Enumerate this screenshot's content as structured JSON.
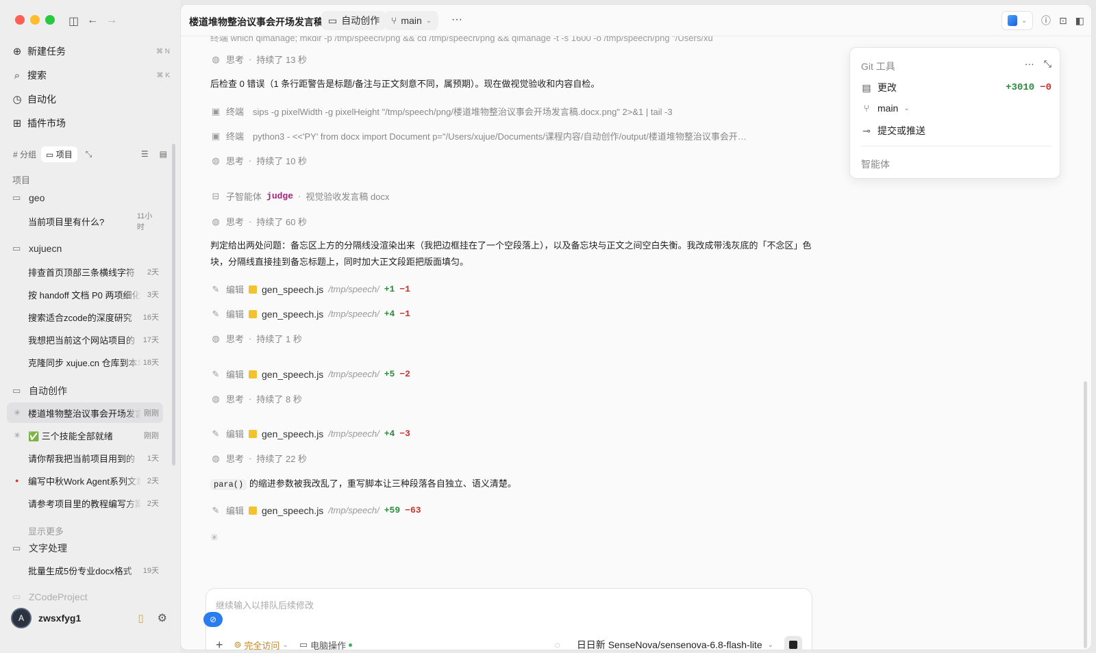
{
  "sidebar": {
    "nav": [
      {
        "icon": "new-task-icon",
        "label": "新建任务",
        "shortcut": "⌘ N"
      },
      {
        "icon": "search-icon",
        "label": "搜索",
        "shortcut": "⌘ K"
      },
      {
        "icon": "automation-icon",
        "label": "自动化",
        "shortcut": ""
      },
      {
        "icon": "plugin-icon",
        "label": "插件市场",
        "shortcut": ""
      }
    ],
    "tabs": {
      "group": "# 分组",
      "project": "项目"
    },
    "section_label": "项目",
    "projects": [
      {
        "name": "geo",
        "items": [
          {
            "title": "当前项目里有什么?",
            "time": "11小时"
          }
        ]
      },
      {
        "name": "xujuecn",
        "items": [
          {
            "title": "排查首页顶部三条横线字符",
            "time": "2天"
          },
          {
            "title": "按 handoff 文档 P0 两项细化",
            "time": "3天"
          },
          {
            "title": "搜索适合zcode的深度研究",
            "time": "16天"
          },
          {
            "title": "我想把当前这个网站项目的",
            "time": "17天"
          },
          {
            "title": "克隆同步 xujue.cn 仓库到本地",
            "time": "18天"
          }
        ]
      },
      {
        "name": "自动创作",
        "items": [
          {
            "title": "楼道堆物整治议事会开场发言稿",
            "time": "刚刚"
          },
          {
            "title": "✅ 三个技能全部就绪",
            "time": "刚刚"
          },
          {
            "title": "请你帮我把当前项目用到的",
            "time": "1天"
          },
          {
            "title": "编写中秋Work Agent系列文章",
            "time": "2天"
          },
          {
            "title": "请参考项目里的教程编写方案",
            "time": "2天"
          }
        ],
        "more": "显示更多"
      },
      {
        "name": "文字处理",
        "items": [
          {
            "title": "批量生成5份专业docx格式",
            "time": "19天"
          }
        ]
      },
      {
        "name": "ZCodeProject",
        "items": []
      }
    ],
    "user": {
      "name": "zwsxfyg1",
      "avatar_text": "A"
    }
  },
  "header": {
    "title": "楼道堆物整治议事会开场发言稿",
    "folder": "自动创作",
    "branch": "main",
    "more": "···"
  },
  "transcript": {
    "clipped_line": "终端  which qlmanage; mkdir -p /tmp/speech/png && cd /tmp/speech/png && qlmanage -t -s 1600 -o /tmp/speech/png \"/Users/xu",
    "think_label": "思考",
    "terminal_label": "终端",
    "edit_label": "编辑",
    "subagent_label": "子智能体",
    "rows": {
      "t1": "持续了 13 秒",
      "p1": "后检查 0 错误（1 条行距警告是标题/备注与正文刻意不同，属预期）。现在做视觉验收和内容自检。",
      "cmd1": "sips -g pixelWidth -g pixelHeight \"/tmp/speech/png/楼道堆物整治议事会开场发言稿.docx.png\" 2>&1 | tail -3",
      "cmd2": "python3 - <<'PY' from docx import Document p=\"/Users/xujue/Documents/课程内容/自动创作/output/楼道堆物整治议事会开…",
      "t2": "持续了 10 秒",
      "agent_name": "judge",
      "agent_task": "视觉验收发言稿 docx",
      "t3": "持续了 60 秒",
      "p2": "判定给出两处问题：备忘区上方的分隔线没渲染出来（我把边框挂在了一个空段落上），以及备忘块与正文之间空白失衡。我改成带浅灰底的「不念区」色块，分隔线直接挂到备忘标题上，同时加大正文段距把版面填匀。",
      "t4": "持续了 1 秒",
      "t5": "持续了 8 秒",
      "t6": "持续了 22 秒",
      "p3_code": "para()",
      "p3_text": "的缩进参数被我改乱了，重写脚本让三种段落各自独立、语义清楚。",
      "file": "gen_speech.js",
      "path": "/tmp/speech/",
      "edits": [
        {
          "plus": "+1",
          "minus": "−1"
        },
        {
          "plus": "+4",
          "minus": "−1"
        },
        {
          "plus": "+5",
          "minus": "−2"
        },
        {
          "plus": "+4",
          "minus": "−3"
        },
        {
          "plus": "+59",
          "minus": "−63"
        }
      ]
    }
  },
  "git_panel": {
    "title": "Git 工具",
    "changes_label": "更改",
    "added": "+3010",
    "removed": "−0",
    "branch": "main",
    "commit_label": "提交或推送",
    "agent_label": "智能体"
  },
  "composer": {
    "placeholder": "继续输入以排队后续修改",
    "access": "完全访问",
    "computer": "电脑操作",
    "model": "日日新 SenseNova/sensenova-6.8-flash-lite"
  },
  "colors": {
    "added": "#2f8a3f",
    "removed": "#c23333",
    "accent": "#2a7df0",
    "access": "#c9861a"
  }
}
